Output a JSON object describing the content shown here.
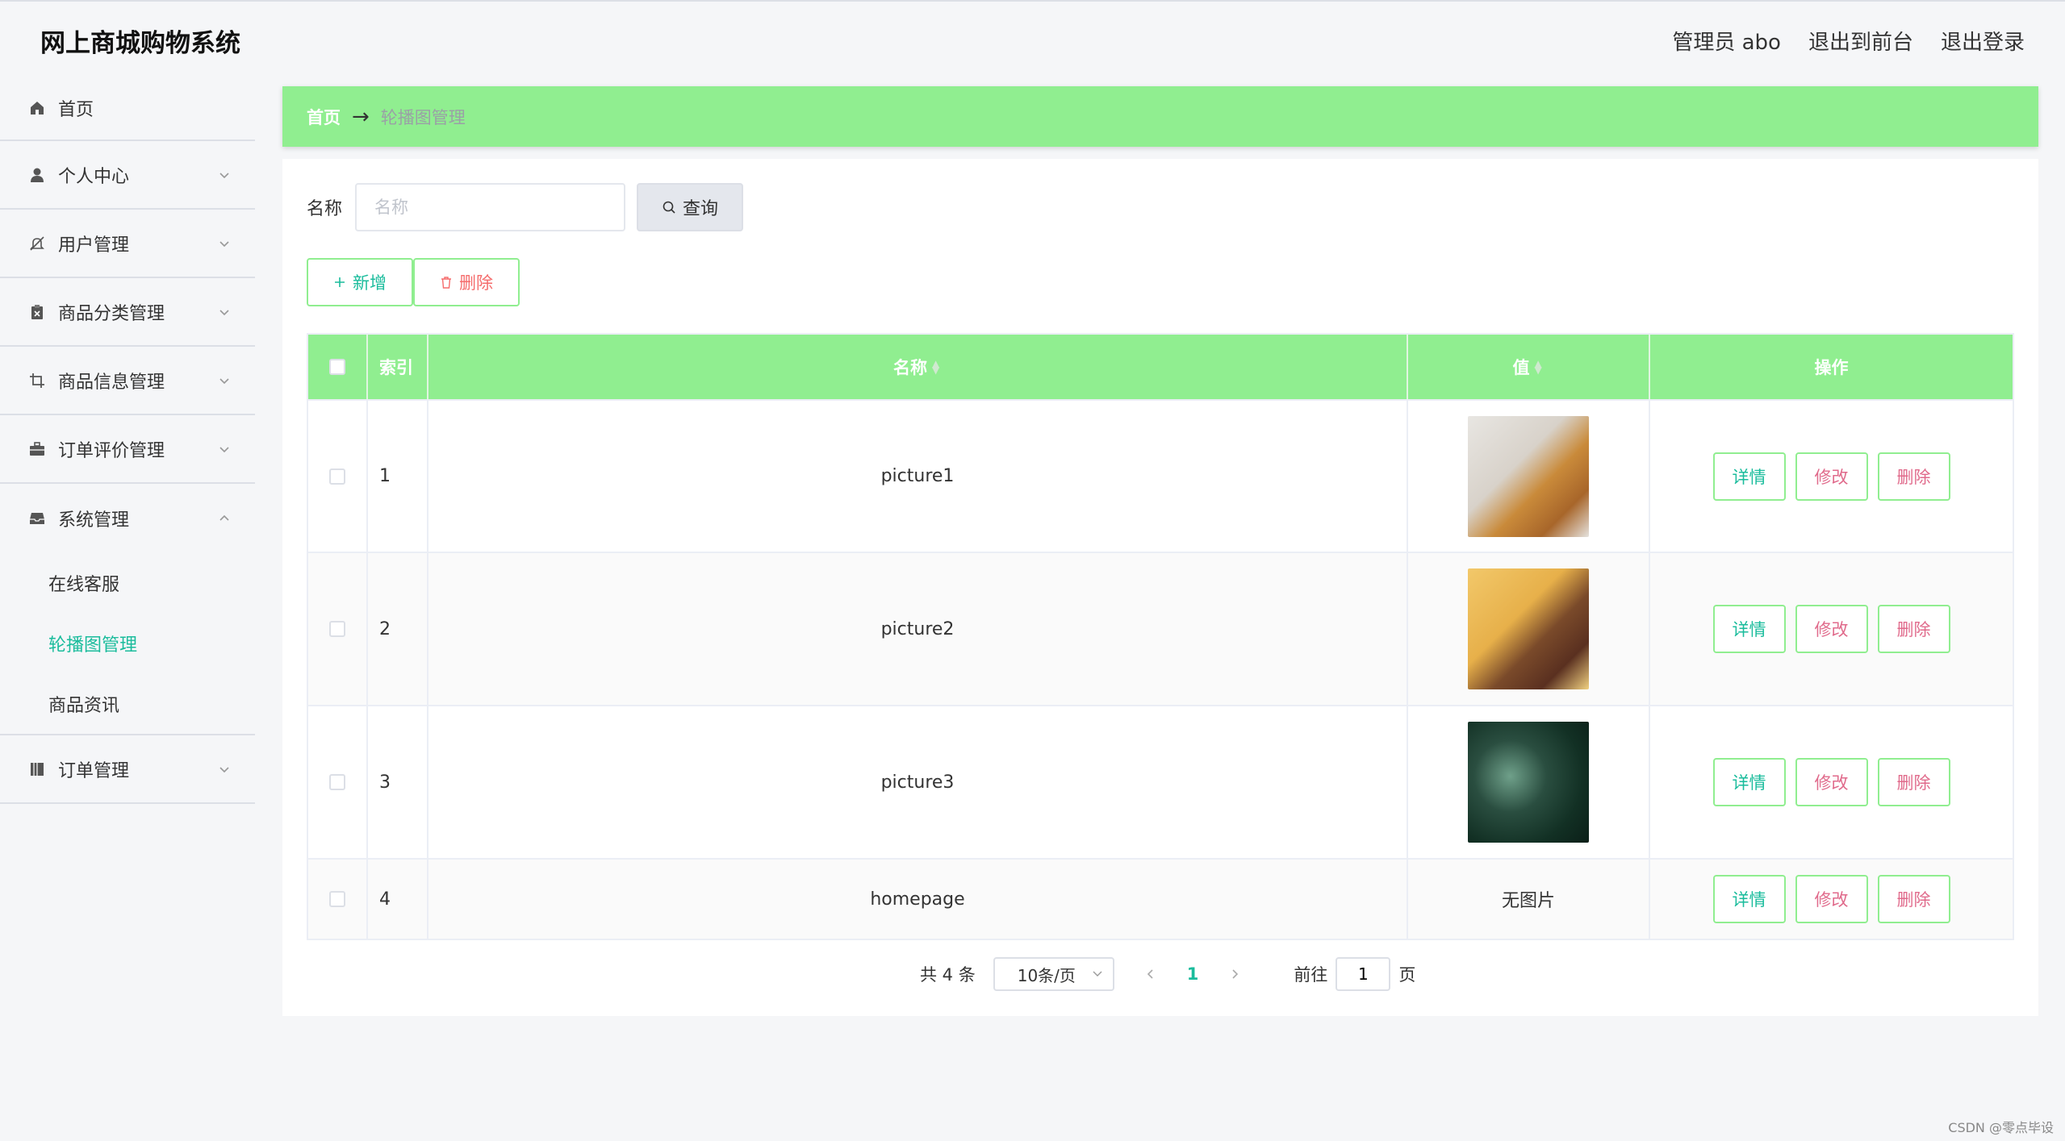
{
  "app": {
    "title": "网上商城购物系统"
  },
  "header": {
    "admin": "管理员 abo",
    "front": "退出到前台",
    "logout": "退出登录"
  },
  "sidebar": {
    "items": [
      {
        "label": "首页",
        "icon": "home-icon"
      },
      {
        "label": "个人中心",
        "icon": "user-icon"
      },
      {
        "label": "用户管理",
        "icon": "bell-off-icon"
      },
      {
        "label": "商品分类管理",
        "icon": "clipboard-icon"
      },
      {
        "label": "商品信息管理",
        "icon": "crop-icon"
      },
      {
        "label": "订单评价管理",
        "icon": "briefcase-icon"
      },
      {
        "label": "系统管理",
        "icon": "inbox-icon"
      },
      {
        "label": "订单管理",
        "icon": "notebook-icon"
      }
    ],
    "system_sub": [
      "在线客服",
      "轮播图管理",
      "商品资讯"
    ]
  },
  "breadcrumb": {
    "home": "首页",
    "separator": "→",
    "current": "轮播图管理"
  },
  "search": {
    "label": "名称",
    "placeholder": "名称",
    "button": "查询"
  },
  "actions": {
    "add": "新增",
    "delete": "删除"
  },
  "table": {
    "headers": {
      "index": "索引",
      "name": "名称",
      "value": "值",
      "ops": "操作"
    },
    "rows": [
      {
        "index": "1",
        "name": "picture1",
        "image": "thumb1",
        "value_text": ""
      },
      {
        "index": "2",
        "name": "picture2",
        "image": "thumb2",
        "value_text": ""
      },
      {
        "index": "3",
        "name": "picture3",
        "image": "thumb3",
        "value_text": ""
      },
      {
        "index": "4",
        "name": "homepage",
        "image": "",
        "value_text": "无图片"
      }
    ],
    "ops": {
      "detail": "详情",
      "edit": "修改",
      "delete": "删除"
    }
  },
  "pagination": {
    "total": "共 4 条",
    "page_size": "10条/页",
    "current": "1",
    "goto_label": "前往",
    "goto_value": "1",
    "page_suffix": "页"
  },
  "watermark": "CSDN @零点毕设",
  "colors": {
    "accent": "#90ee90",
    "active_text": "#1abc9c",
    "danger": "#f56c6c"
  }
}
